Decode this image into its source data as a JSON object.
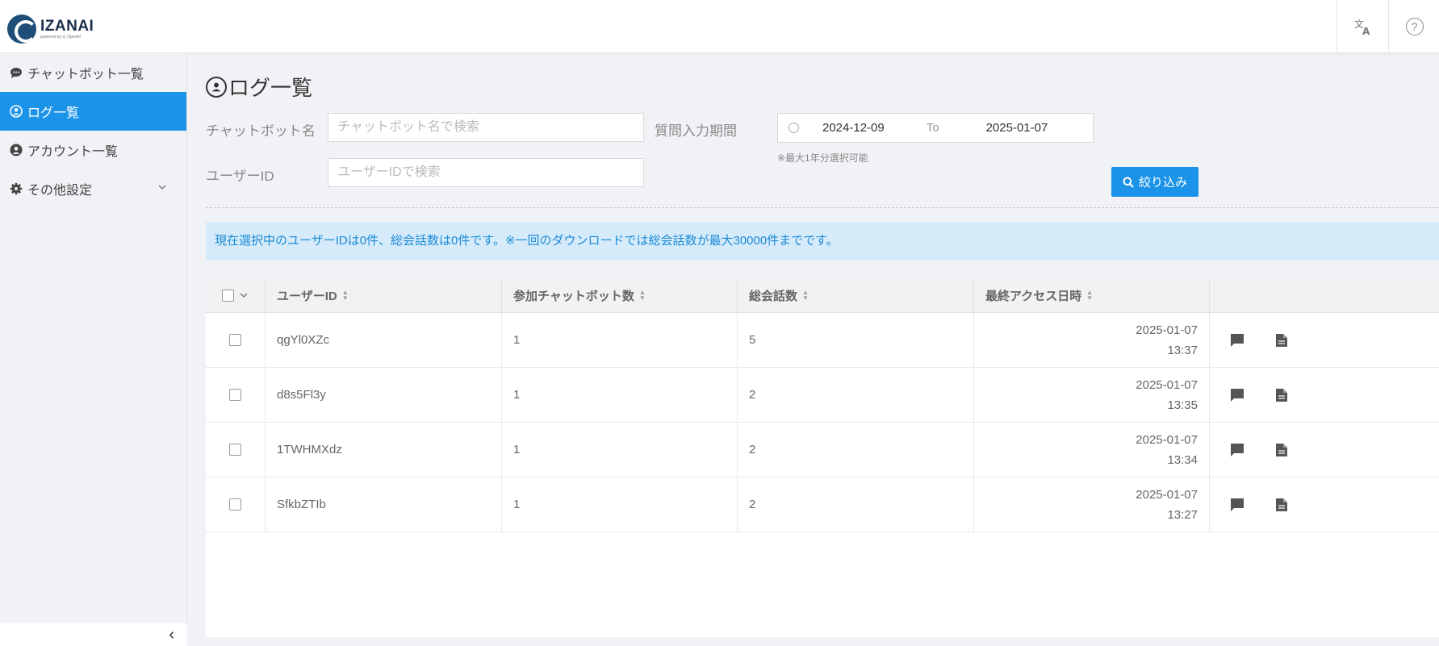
{
  "app": {
    "name": "IZANAI",
    "tagline": "powered by ◎ OpenAI"
  },
  "sidebar": {
    "items": [
      {
        "label": "チャットボット一覧",
        "icon": "chat-bubble-icon"
      },
      {
        "label": "ログ一覧",
        "icon": "user-circle-icon"
      },
      {
        "label": "アカウント一覧",
        "icon": "user-icon"
      },
      {
        "label": "その他設定",
        "icon": "gear-icon"
      }
    ],
    "collapse_glyph": "‹"
  },
  "page": {
    "title": "ログ一覧",
    "filters": {
      "chatbot_label": "チャットボット名",
      "chatbot_placeholder": "チャットボット名で検索",
      "period_label": "質問入力期間",
      "date_from": "2024-12-09",
      "date_sep": "To",
      "date_to": "2025-01-07",
      "period_note": "※最大1年分選択可能",
      "userid_label": "ユーザーID",
      "userid_placeholder": "ユーザーIDで検索",
      "filter_button": "絞り込み"
    },
    "info": "現在選択中のユーザーIDは0件、総会話数は0件です。※一回のダウンロードでは総会話数が最大30000件までです。"
  },
  "table": {
    "columns": [
      "ユーザーID",
      "参加チャットボット数",
      "総会話数",
      "最終アクセス日時"
    ],
    "rows": [
      {
        "user_id": "qgYl0XZc",
        "bots": "1",
        "conversations": "5",
        "date": "2025-01-07",
        "time": "13:37"
      },
      {
        "user_id": "d8s5Fl3y",
        "bots": "1",
        "conversations": "2",
        "date": "2025-01-07",
        "time": "13:35"
      },
      {
        "user_id": "1TWHMXdz",
        "bots": "1",
        "conversations": "2",
        "date": "2025-01-07",
        "time": "13:34"
      },
      {
        "user_id": "SfkbZTIb",
        "bots": "1",
        "conversations": "2",
        "date": "2025-01-07",
        "time": "13:27"
      }
    ]
  }
}
